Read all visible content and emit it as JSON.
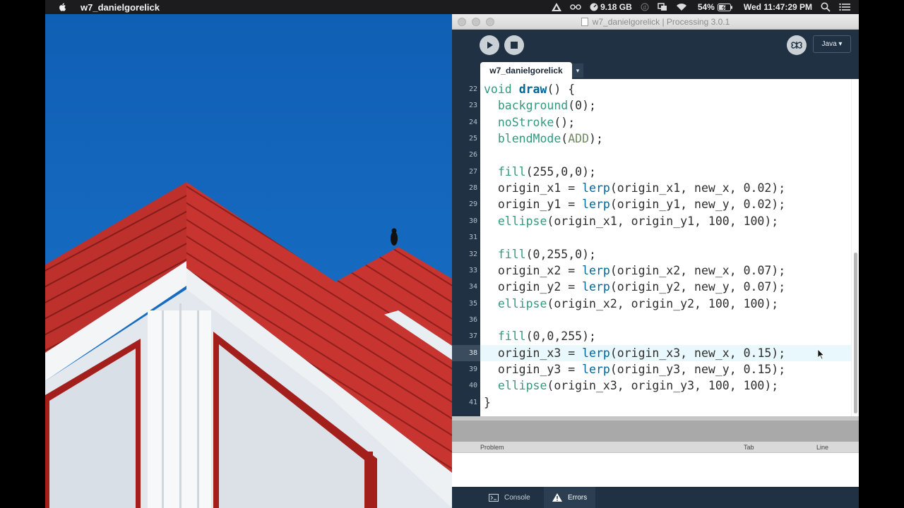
{
  "menubar": {
    "app_name": "w7_danielgorelick",
    "memory": "9.18 GB",
    "battery": "54%",
    "clock": "Wed 11:47:29 PM"
  },
  "window": {
    "title": "w7_danielgorelick | Processing 3.0.1",
    "mode": "Java ▾",
    "tab_label": "w7_danielgorelick",
    "tab_menu": "▾"
  },
  "editor": {
    "current_line": 38,
    "lines": [
      {
        "n": "22",
        "code": "void draw() {"
      },
      {
        "n": "23",
        "code": "  background(0);"
      },
      {
        "n": "24",
        "code": "  noStroke();"
      },
      {
        "n": "25",
        "code": "  blendMode(ADD);"
      },
      {
        "n": "26",
        "code": ""
      },
      {
        "n": "27",
        "code": "  fill(255,0,0);"
      },
      {
        "n": "28",
        "code": "  origin_x1 = lerp(origin_x1, new_x, 0.02);"
      },
      {
        "n": "29",
        "code": "  origin_y1 = lerp(origin_y1, new_y, 0.02);"
      },
      {
        "n": "30",
        "code": "  ellipse(origin_x1, origin_y1, 100, 100);"
      },
      {
        "n": "31",
        "code": ""
      },
      {
        "n": "32",
        "code": "  fill(0,255,0);"
      },
      {
        "n": "33",
        "code": "  origin_x2 = lerp(origin_x2, new_x, 0.07);"
      },
      {
        "n": "34",
        "code": "  origin_y2 = lerp(origin_y2, new_y, 0.07);"
      },
      {
        "n": "35",
        "code": "  ellipse(origin_x2, origin_y2, 100, 100);"
      },
      {
        "n": "36",
        "code": ""
      },
      {
        "n": "37",
        "code": "  fill(0,0,255);"
      },
      {
        "n": "38",
        "code": "  origin_x3 = lerp(origin_x3, new_x, 0.15);"
      },
      {
        "n": "39",
        "code": "  origin_y3 = lerp(origin_y3, new_y, 0.15);"
      },
      {
        "n": "40",
        "code": "  ellipse(origin_x3, origin_y3, 100, 100);"
      },
      {
        "n": "41",
        "code": "}"
      }
    ]
  },
  "errors_table": {
    "col_problem": "Problem",
    "col_tab": "Tab",
    "col_line": "Line"
  },
  "footer": {
    "console_label": "Console",
    "errors_label": "Errors"
  },
  "colors": {
    "window_chrome": "#1f3143",
    "keyword": "#33997e",
    "function": "#006699",
    "sky": "#1565b8",
    "roof": "#c23a33"
  }
}
